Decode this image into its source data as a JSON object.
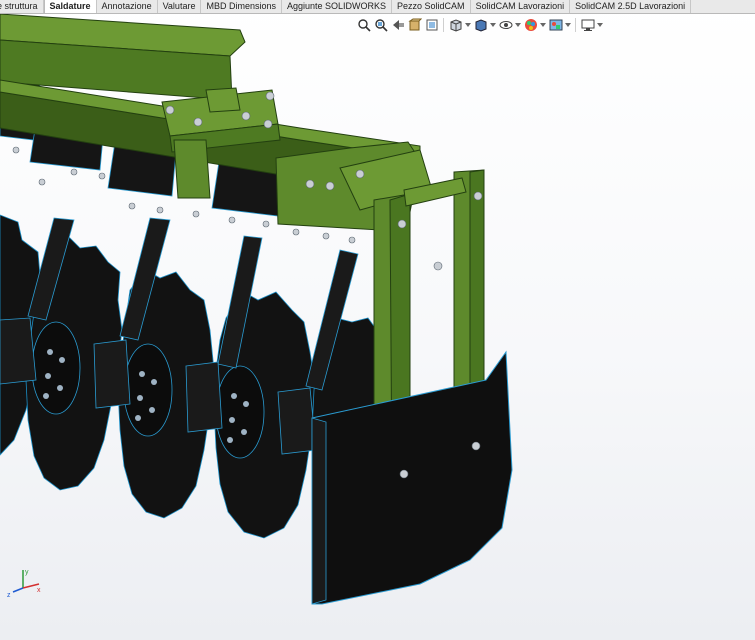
{
  "command_manager": {
    "tabs": [
      {
        "label": "e struttura",
        "active": false
      },
      {
        "label": "Saldature",
        "active": true
      },
      {
        "label": "Annotazione",
        "active": false
      },
      {
        "label": "Valutare",
        "active": false
      },
      {
        "label": "MBD Dimensions",
        "active": false
      },
      {
        "label": "Aggiunte SOLIDWORKS",
        "active": false
      },
      {
        "label": "Pezzo SolidCAM",
        "active": false
      },
      {
        "label": "SolidCAM Lavorazioni",
        "active": false
      },
      {
        "label": "SolidCAM 2.5D Lavorazioni",
        "active": false
      }
    ]
  },
  "headsup_toolbar": {
    "icons": [
      "zoom-to-fit-icon",
      "zoom-to-area-icon",
      "previous-view-icon",
      "section-view-icon",
      "dynamic-annotation-icon",
      "view-orientation-icon",
      "display-style-icon",
      "hide-show-items-icon",
      "edit-appearance-icon",
      "apply-scene-icon",
      "view-settings-icon"
    ]
  },
  "colors": {
    "tab_bar": "#e9e9e9",
    "frame_green": "#5e8a2c",
    "frame_green_dark": "#3f6419",
    "disc_black": "#121212",
    "edge_blue": "#3aa3d6",
    "bolt_silver": "#c9ced4"
  },
  "triad": {
    "x_label": "x",
    "y_label": "y",
    "z_label": "z"
  }
}
